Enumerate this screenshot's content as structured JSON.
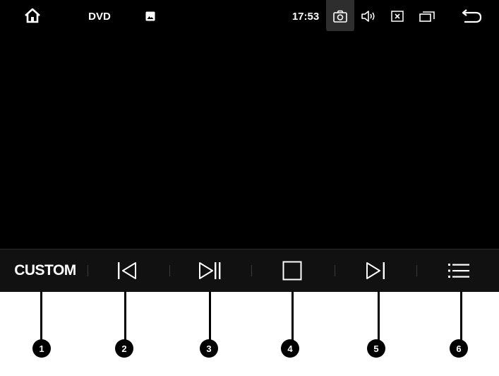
{
  "status_bar": {
    "source_label": "DVD",
    "time": "17:53"
  },
  "controls": {
    "custom_label": "CUSTOM",
    "items": [
      {
        "name": "custom-button"
      },
      {
        "name": "previous-button",
        "icon": "skip-previous-icon"
      },
      {
        "name": "play-pause-button",
        "icon": "play-pause-icon"
      },
      {
        "name": "stop-button",
        "icon": "stop-icon"
      },
      {
        "name": "next-button",
        "icon": "skip-next-icon"
      },
      {
        "name": "menu-button",
        "icon": "list-menu-icon"
      }
    ]
  },
  "callouts": {
    "labels": [
      "1",
      "2",
      "3",
      "4",
      "5",
      "6"
    ]
  }
}
